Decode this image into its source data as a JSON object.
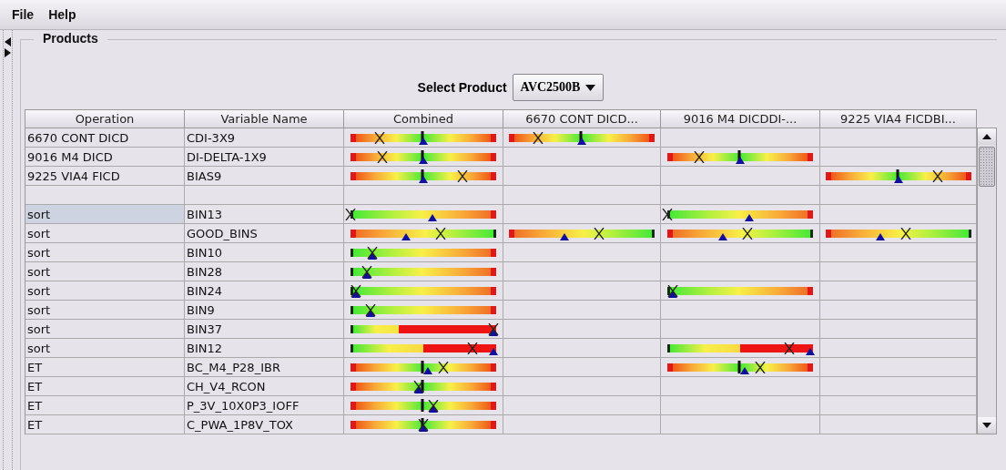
{
  "menu_bar": {
    "items": [
      "File",
      "Help"
    ]
  },
  "products_panel": {
    "title": "Products",
    "select_product": {
      "label": "Select Product",
      "value": "AVC2500B"
    }
  },
  "table": {
    "columns": [
      "Operation",
      "Variable Name",
      "Combined",
      "6670 CONT DICD...",
      "9016 M4 DICDDI-...",
      "9225 VIA4 FICDBI..."
    ],
    "rows": [
      {
        "selected": false,
        "operation": "6670 CONT DICD",
        "variable": "CDI-3X9",
        "gauges": {
          "combined": {
            "kind": "centered",
            "level": 0.2,
            "target": {
              "level": 0.5
            }
          },
          "column_4": {
            "kind": "centered",
            "level": 0.2,
            "target": {
              "level": 0.5
            }
          }
        }
      },
      {
        "selected": false,
        "operation": "9016 M4 DICD",
        "variable": "DI-DELTA-1X9",
        "gauges": {
          "combined": {
            "kind": "centered",
            "level": 0.22,
            "target": {
              "level": 0.5
            }
          },
          "column_5": {
            "kind": "centered",
            "level": 0.22,
            "target": {
              "level": 0.5
            }
          }
        }
      },
      {
        "selected": false,
        "operation": "9225 VIA4 FICD",
        "variable": "BIAS9",
        "gauges": {
          "combined": {
            "kind": "centered",
            "level": 0.77,
            "target": {
              "level": 0.5
            }
          },
          "column_6": {
            "kind": "centered",
            "level": 0.77,
            "target": {
              "level": 0.5
            }
          }
        }
      },
      {
        "selected": false
      },
      {
        "selected": true,
        "operation": "sort",
        "variable": "BIN13",
        "gauges": {
          "combined": {
            "kind": "low_good",
            "level": 0,
            "target": {
              "level": 0.56
            }
          },
          "column_5": {
            "kind": "low_good",
            "level": 0,
            "target": {
              "level": 0.56
            }
          }
        }
      },
      {
        "selected": false,
        "operation": "sort",
        "variable": "GOOD_BINS",
        "gauges": {
          "combined": {
            "kind": "high_good",
            "level": 0.62,
            "target": {
              "level": 0.38
            }
          },
          "column_4": {
            "kind": "high_good",
            "level": 0.62,
            "target": {
              "level": 0.38
            }
          },
          "column_5": {
            "kind": "high_good",
            "level": 0.55,
            "target": {
              "level": 0.38
            }
          },
          "column_6": {
            "kind": "high_good",
            "level": 0.55,
            "target": {
              "level": 0.38
            }
          }
        }
      },
      {
        "selected": false,
        "operation": "sort",
        "variable": "BIN10",
        "gauges": {
          "combined": {
            "kind": "low_good",
            "level": 0.15,
            "target": {
              "level": 0.15
            }
          }
        }
      },
      {
        "selected": false,
        "operation": "sort",
        "variable": "BIN28",
        "gauges": {
          "combined": {
            "kind": "low_good",
            "level": 0.11,
            "target": {
              "level": 0.11
            }
          }
        }
      },
      {
        "selected": false,
        "operation": "sort",
        "variable": "BIN24",
        "gauges": {
          "combined": {
            "kind": "low_good",
            "level": 0.04,
            "target": {
              "level": 0.04
            }
          },
          "column_5": {
            "kind": "low_good",
            "level": 0.04,
            "target": {
              "level": 0.04
            }
          }
        }
      },
      {
        "selected": false,
        "operation": "sort",
        "variable": "BIN9",
        "gauges": {
          "combined": {
            "kind": "low_good",
            "level": 0.14,
            "target": {
              "level": 0.14
            }
          }
        }
      },
      {
        "selected": false,
        "operation": "sort",
        "variable": "BIN37",
        "gauges": {
          "combined": {
            "kind": "low_good",
            "level": 0.98,
            "target": {
              "level": 0.98
            },
            "red_zone": {
              "level": 0.68
            }
          }
        }
      },
      {
        "selected": false,
        "operation": "sort",
        "variable": "BIN12",
        "gauges": {
          "combined": {
            "kind": "low_good",
            "level": 0.84,
            "target": {
              "level": 0.98
            },
            "red_zone": {
              "level": 0.51
            }
          },
          "column_5": {
            "kind": "low_good",
            "level": 0.84,
            "target": {
              "level": 0.98
            },
            "red_zone": {
              "level": 0.51
            }
          }
        }
      },
      {
        "selected": false,
        "operation": "ET",
        "variable": "BC_M4_P28_IBR",
        "gauges": {
          "combined": {
            "kind": "centered",
            "level": 0.64,
            "target": {
              "level": 0.53
            }
          },
          "column_5": {
            "kind": "centered",
            "level": 0.64,
            "target": {
              "level": 0.53
            }
          }
        }
      },
      {
        "selected": false,
        "operation": "ET",
        "variable": "CH_V4_RCON",
        "gauges": {
          "combined": {
            "kind": "centered",
            "level": 0.47,
            "target": {
              "level": 0.47
            }
          }
        }
      },
      {
        "selected": false,
        "operation": "ET",
        "variable": "P_3V_10X0P3_IOFF",
        "gauges": {
          "combined": {
            "kind": "centered",
            "level": 0.57,
            "target": {
              "level": 0.57
            }
          }
        }
      },
      {
        "selected": false,
        "operation": "ET",
        "variable": "C_PWA_1P8V_TOX",
        "gauges": {
          "combined": {
            "kind": "centered",
            "level": 0.5,
            "target": {
              "level": 0.5
            }
          }
        }
      }
    ]
  }
}
